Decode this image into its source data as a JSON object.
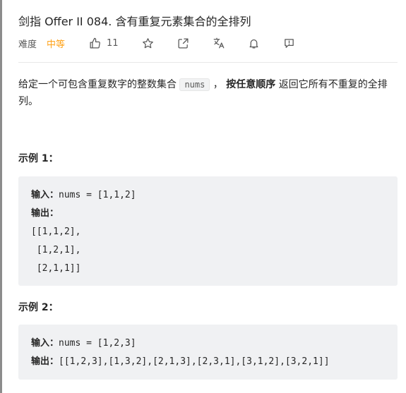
{
  "problem": {
    "title": "剑指 Offer II 084. 含有重复元素集合的全排列",
    "difficulty_label": "难度",
    "difficulty_value": "中等",
    "likes": "11"
  },
  "colors": {
    "difficulty": "#ffa116",
    "code_bg": "#f0f1f3"
  },
  "icons": [
    "thumbs-up-icon",
    "star-icon",
    "share-icon",
    "translate-icon",
    "bell-icon",
    "feedback-icon"
  ],
  "description": {
    "part1": "给定一个可包含重复数字的整数集合 ",
    "code": "nums",
    "part2": " ， ",
    "bold": "按任意顺序",
    "part3": " 返回它所有不重复的全排列。"
  },
  "examples": [
    {
      "title": "示例 1：",
      "input_label": "输入：",
      "input_value": "nums = [1,1,2]",
      "output_label": "输出：",
      "output_lines": [
        "[[1,1,2],",
        " [1,2,1],",
        " [2,1,1]]"
      ]
    },
    {
      "title": "示例 2：",
      "input_label": "输入：",
      "input_value": "nums = [1,2,3]",
      "output_label": "输出：",
      "output_value": "[[1,2,3],[1,3,2],[2,1,3],[2,3,1],[3,1,2],[3,2,1]]"
    }
  ]
}
